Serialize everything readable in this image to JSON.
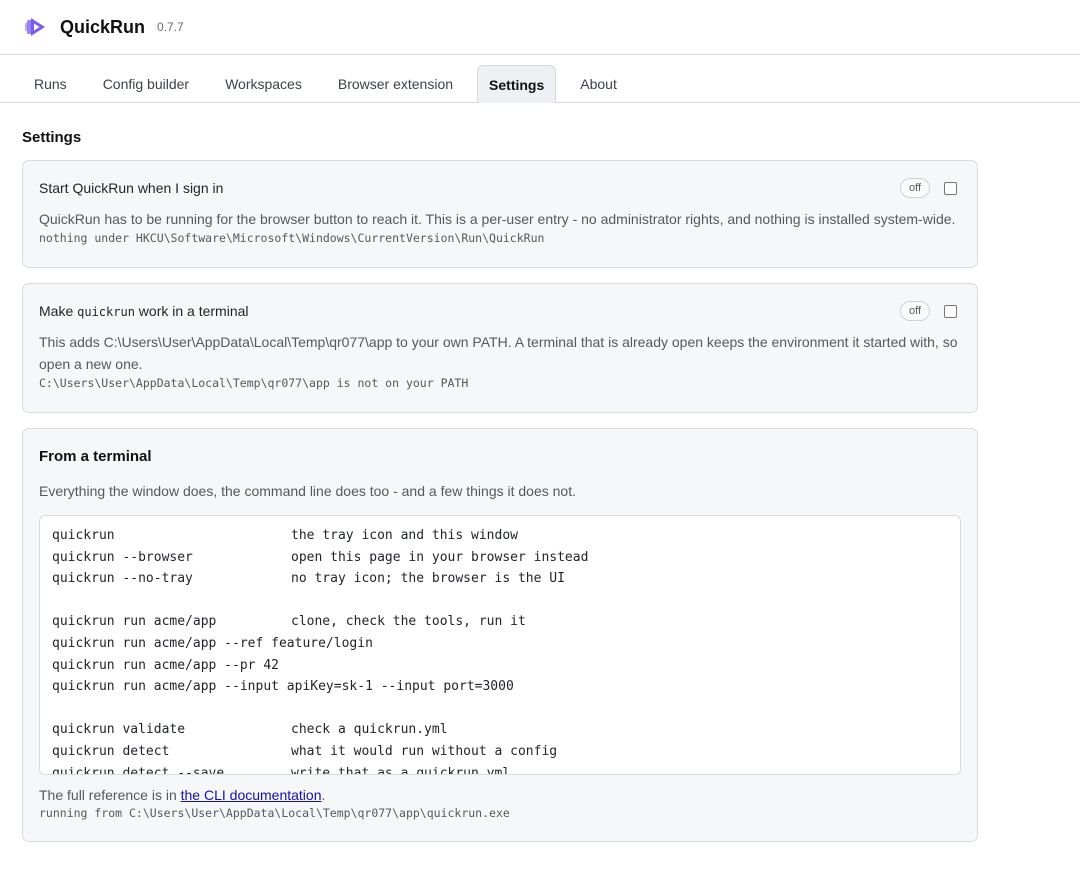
{
  "app": {
    "name": "QuickRun",
    "version": "0.7.7",
    "accent": "#7b5cf0"
  },
  "tabs": [
    {
      "label": "Runs",
      "active": false
    },
    {
      "label": "Config builder",
      "active": false
    },
    {
      "label": "Workspaces",
      "active": false
    },
    {
      "label": "Browser extension",
      "active": false
    },
    {
      "label": "Settings",
      "active": true
    },
    {
      "label": "About",
      "active": false
    }
  ],
  "settings": {
    "title": "Settings",
    "startup": {
      "title": "Start QuickRun when I sign in",
      "state": "off",
      "checked": false,
      "description": "QuickRun has to be running for the browser button to reach it. This is a per-user entry - no administrator rights, and nothing is installed system-wide.",
      "status": "nothing under HKCU\\Software\\Microsoft\\Windows\\CurrentVersion\\Run\\QuickRun"
    },
    "path": {
      "title_prefix": "Make ",
      "title_code": "quickrun",
      "title_suffix": " work in a terminal",
      "state": "off",
      "checked": false,
      "description": "This adds C:\\Users\\User\\AppData\\Local\\Temp\\qr077\\app to your own PATH. A terminal that is already open keeps the environment it started with, so open a new one.",
      "status": "C:\\Users\\User\\AppData\\Local\\Temp\\qr077\\app is not on your PATH"
    },
    "terminal": {
      "title": "From a terminal",
      "description": "Everything the window does, the command line does too - and a few things it does not.",
      "commands": [
        {
          "cmd": "quickrun",
          "desc": "the tray icon and this window"
        },
        {
          "cmd": "quickrun --browser",
          "desc": "open this page in your browser instead"
        },
        {
          "cmd": "quickrun --no-tray",
          "desc": "no tray icon; the browser is the UI"
        },
        {
          "cmd": "",
          "desc": ""
        },
        {
          "cmd": "quickrun run acme/app",
          "desc": "clone, check the tools, run it"
        },
        {
          "cmd": "quickrun run acme/app --ref feature/login",
          "desc": ""
        },
        {
          "cmd": "quickrun run acme/app --pr 42",
          "desc": ""
        },
        {
          "cmd": "quickrun run acme/app --input apiKey=sk-1 --input port=3000",
          "desc": ""
        },
        {
          "cmd": "",
          "desc": ""
        },
        {
          "cmd": "quickrun validate",
          "desc": "check a quickrun.yml"
        },
        {
          "cmd": "quickrun detect",
          "desc": "what it would run without a config"
        },
        {
          "cmd": "quickrun detect --save",
          "desc": "write that as a quickrun.yml"
        }
      ],
      "reference_prefix": "The full reference is in ",
      "reference_link": "the CLI documentation",
      "reference_suffix": ".",
      "running_from": "running from C:\\Users\\User\\AppData\\Local\\Temp\\qr077\\app\\quickrun.exe"
    }
  }
}
